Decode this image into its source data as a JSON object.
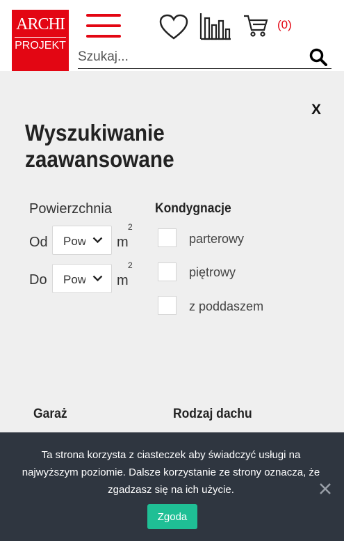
{
  "header": {
    "logo_top": "ARCHI",
    "logo_bottom": "PROJEKT",
    "cart_count": "(0)",
    "search_placeholder": "Szukaj..."
  },
  "panel": {
    "close_label": "X",
    "title": "Wyszukiwanie zaawansowane",
    "area": {
      "label": "Powierzchnia",
      "from_label": "Od",
      "to_label": "Do",
      "from_value": "Pow",
      "to_value": "Pow",
      "unit": "m",
      "unit_exp": "2"
    },
    "floors": {
      "label": "Kondygnacje",
      "options": [
        "parterowy",
        "piętrowy",
        "z poddaszem"
      ]
    },
    "garage_label": "Garaż",
    "roof_label": "Rodzaj dachu"
  },
  "cookie": {
    "text": "Ta strona korzysta z ciasteczek aby świadczyć usługi na najwyższym poziomie. Dalsze korzystanie ze strony oznacza, że zgadzasz się na ich użycie.",
    "accept_label": "Zgoda"
  },
  "colors": {
    "brand": "#e30613",
    "accept": "#1fbf95",
    "cookie_bg": "#2f3640"
  },
  "icons": [
    "hamburger-icon",
    "heart-icon",
    "compare-icon",
    "cart-icon",
    "search-icon",
    "close-icon",
    "chevron-down-icon"
  ]
}
